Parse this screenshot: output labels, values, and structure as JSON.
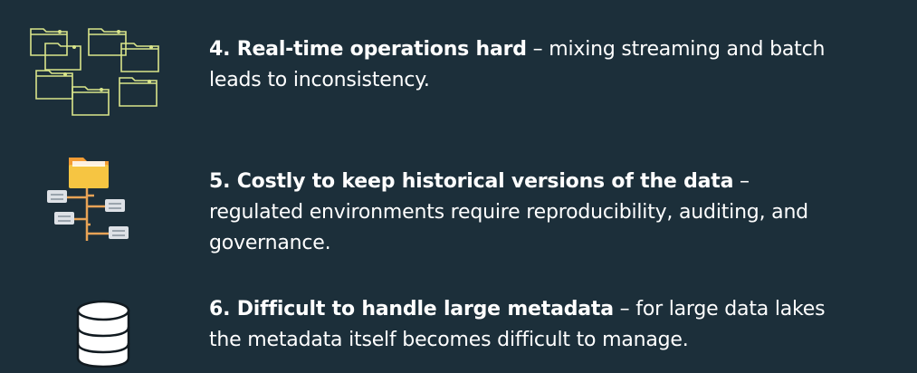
{
  "items": [
    {
      "icon": "folders-outline-icon",
      "title": "4. Real-time operations hard",
      "separator": " – ",
      "description": "mixing streaming and batch leads to inconsistency."
    },
    {
      "icon": "folder-tree-icon",
      "title": "5. Costly to keep historical versions of the data",
      "separator": " – ",
      "description": "regulated environments require reproducibility, auditing, and governance."
    },
    {
      "icon": "database-icon",
      "title": "6. Difficult to handle large metadata",
      "separator": " – ",
      "description": "for large data lakes the metadata itself becomes difficult to manage."
    }
  ],
  "colors": {
    "background": "#1c2f3a",
    "folder_outline": "#d9e58a",
    "folder_yellow": "#f6c542",
    "folder_orange": "#f39c34",
    "tree_line": "#e8a356",
    "box_gray": "#dde1e6",
    "text": "#ffffff"
  }
}
